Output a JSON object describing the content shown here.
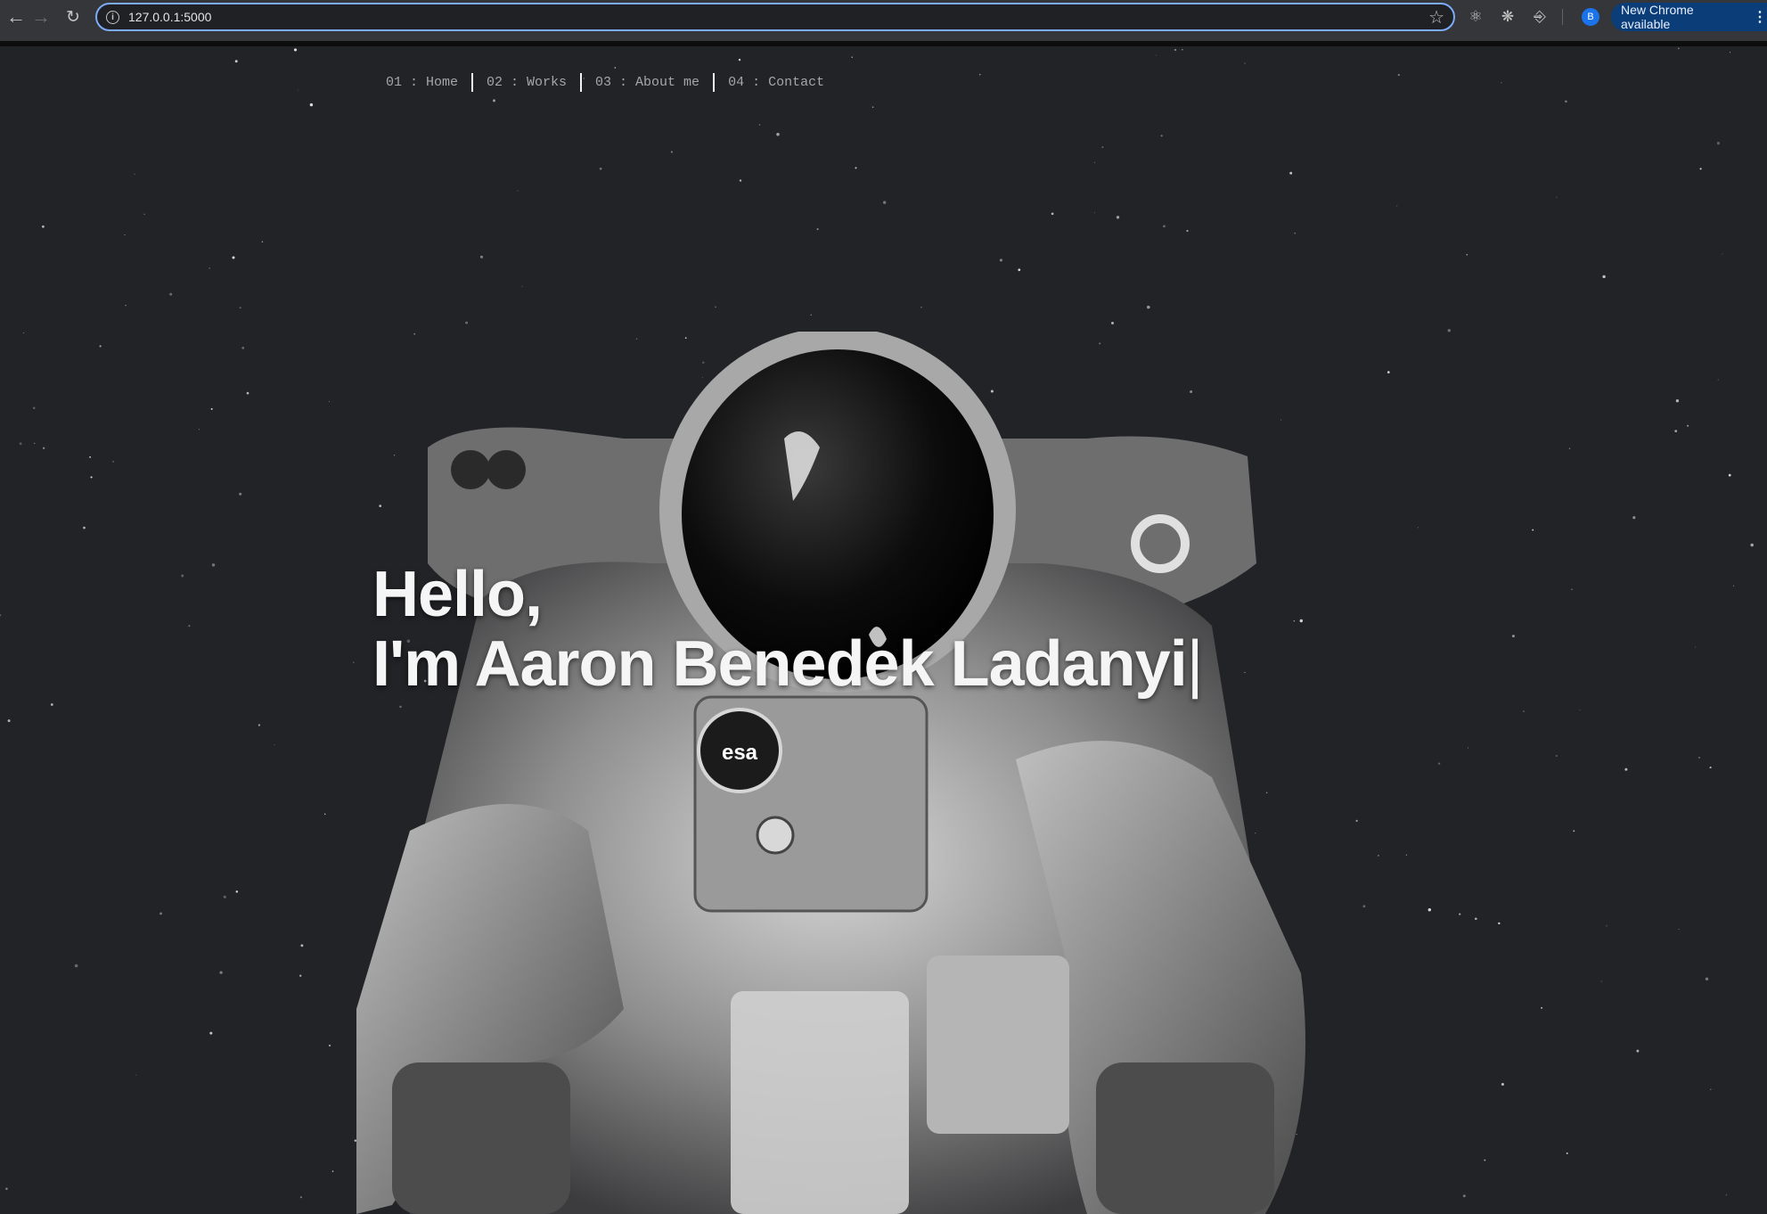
{
  "browser": {
    "url": "127.0.0.1:5000",
    "update_label": "New Chrome available",
    "profile_initial": "B"
  },
  "nav": {
    "items": [
      {
        "label": "01 : Home"
      },
      {
        "label": "02 : Works"
      },
      {
        "label": "03 : About me"
      },
      {
        "label": "04 : Contact"
      }
    ]
  },
  "hero": {
    "line1": "Hello,",
    "line2": "I'm Aaron Benedek Ladanyi",
    "cursor": "|"
  },
  "image": {
    "patch_text": "esa"
  },
  "colors": {
    "background": "#222326",
    "accent": "#7cacf8",
    "text": "#f5f5f5"
  }
}
